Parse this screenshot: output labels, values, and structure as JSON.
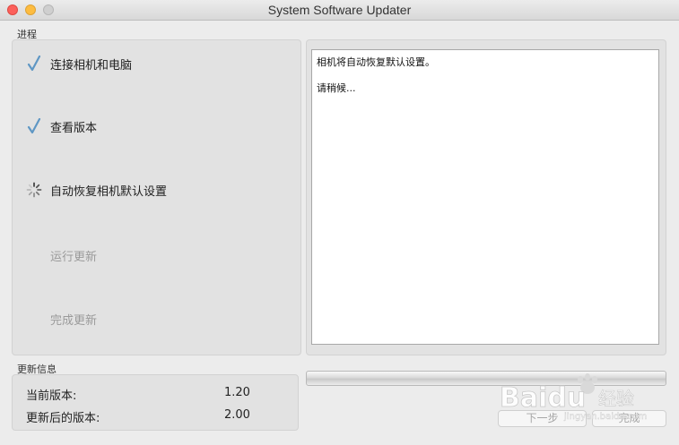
{
  "window": {
    "title": "System Software Updater"
  },
  "progress_section": {
    "label": "进程",
    "steps": [
      {
        "label": "连接相机和电脑",
        "state": "done",
        "icon": "checkmark-icon"
      },
      {
        "label": "查看版本",
        "state": "done",
        "icon": "checkmark-icon"
      },
      {
        "label": "自动恢复相机默认设置",
        "state": "active",
        "icon": "spinner-icon"
      },
      {
        "label": "运行更新",
        "state": "pending",
        "icon": ""
      },
      {
        "label": "完成更新",
        "state": "pending",
        "icon": ""
      }
    ]
  },
  "log": {
    "lines": [
      "相机将自动恢复默认设置。",
      "请稍候..."
    ]
  },
  "progress_bar": {
    "value_fraction": 0
  },
  "update_info": {
    "label": "更新信息",
    "current_version_label": "当前版本:",
    "current_version": "1.20",
    "new_version_label": "更新后的版本:",
    "new_version": "2.00"
  },
  "buttons": {
    "next_label": "下一步",
    "finish_label": "完成"
  },
  "watermark": {
    "brand": "Baidu",
    "suffix": "经验",
    "url": "jingyan.baidu.com"
  },
  "colors": {
    "check": "#5f97c4",
    "spinner": "#8a8a8a",
    "disabled_text": "#9a9a9a",
    "close": "#fc605b",
    "minimize": "#fdbc40",
    "zoom": "#cfcfcf"
  }
}
